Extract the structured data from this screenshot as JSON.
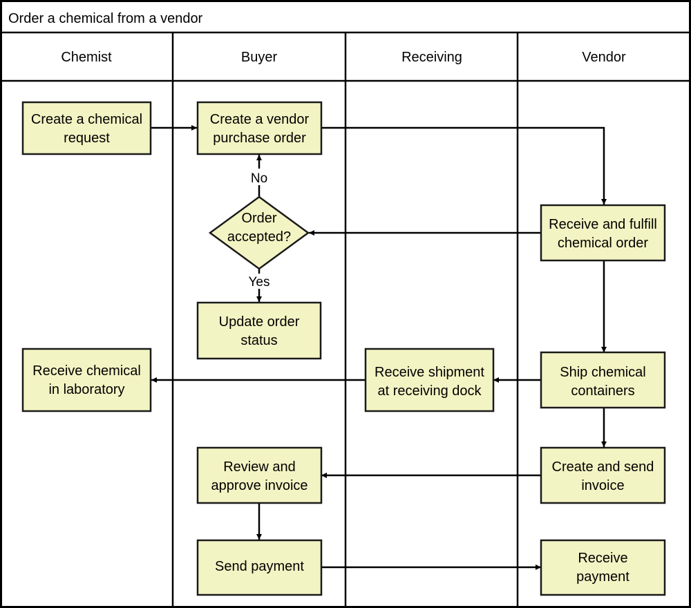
{
  "title": "Order a chemical from a vendor",
  "lanes": [
    {
      "id": "chemist",
      "label": "Chemist"
    },
    {
      "id": "buyer",
      "label": "Buyer"
    },
    {
      "id": "receiving",
      "label": "Receiving"
    },
    {
      "id": "vendor",
      "label": "Vendor"
    }
  ],
  "nodes": [
    {
      "id": "create-chemical-request",
      "type": "process",
      "lane": "chemist",
      "lines": [
        "Create a chemical",
        "request"
      ]
    },
    {
      "id": "create-vendor-po",
      "type": "process",
      "lane": "buyer",
      "lines": [
        "Create a vendor",
        "purchase order"
      ]
    },
    {
      "id": "order-accepted",
      "type": "decision",
      "lane": "buyer",
      "lines": [
        "Order",
        "accepted?"
      ]
    },
    {
      "id": "update-order-status",
      "type": "process",
      "lane": "buyer",
      "lines": [
        "Update order",
        "status"
      ]
    },
    {
      "id": "receive-fulfill-order",
      "type": "process",
      "lane": "vendor",
      "lines": [
        "Receive and fulfill",
        "chemical order"
      ]
    },
    {
      "id": "receive-chemical-lab",
      "type": "process",
      "lane": "chemist",
      "lines": [
        "Receive chemical",
        "in laboratory"
      ]
    },
    {
      "id": "receive-shipment-dock",
      "type": "process",
      "lane": "receiving",
      "lines": [
        "Receive shipment",
        "at receiving dock"
      ]
    },
    {
      "id": "ship-containers",
      "type": "process",
      "lane": "vendor",
      "lines": [
        "Ship chemical",
        "containers"
      ]
    },
    {
      "id": "review-approve-invoice",
      "type": "process",
      "lane": "buyer",
      "lines": [
        "Review and",
        "approve invoice"
      ]
    },
    {
      "id": "create-send-invoice",
      "type": "process",
      "lane": "vendor",
      "lines": [
        "Create and send",
        "invoice"
      ]
    },
    {
      "id": "send-payment",
      "type": "process",
      "lane": "buyer",
      "lines": [
        "Send payment"
      ]
    },
    {
      "id": "receive-payment",
      "type": "process",
      "lane": "vendor",
      "lines": [
        "Receive",
        "payment"
      ]
    }
  ],
  "edges": [
    {
      "from": "create-chemical-request",
      "to": "create-vendor-po",
      "label": ""
    },
    {
      "from": "create-vendor-po",
      "to": "receive-fulfill-order",
      "label": ""
    },
    {
      "from": "receive-fulfill-order",
      "to": "order-accepted",
      "label": ""
    },
    {
      "from": "order-accepted",
      "to": "create-vendor-po",
      "label": "No"
    },
    {
      "from": "order-accepted",
      "to": "update-order-status",
      "label": "Yes"
    },
    {
      "from": "receive-fulfill-order",
      "to": "ship-containers",
      "label": ""
    },
    {
      "from": "ship-containers",
      "to": "receive-shipment-dock",
      "label": ""
    },
    {
      "from": "receive-shipment-dock",
      "to": "receive-chemical-lab",
      "label": ""
    },
    {
      "from": "ship-containers",
      "to": "create-send-invoice",
      "label": ""
    },
    {
      "from": "create-send-invoice",
      "to": "review-approve-invoice",
      "label": ""
    },
    {
      "from": "review-approve-invoice",
      "to": "send-payment",
      "label": ""
    },
    {
      "from": "send-payment",
      "to": "receive-payment",
      "label": ""
    }
  ],
  "colors": {
    "process_fill": "#f3f4c3",
    "stroke": "#000000",
    "background": "#ffffff"
  }
}
